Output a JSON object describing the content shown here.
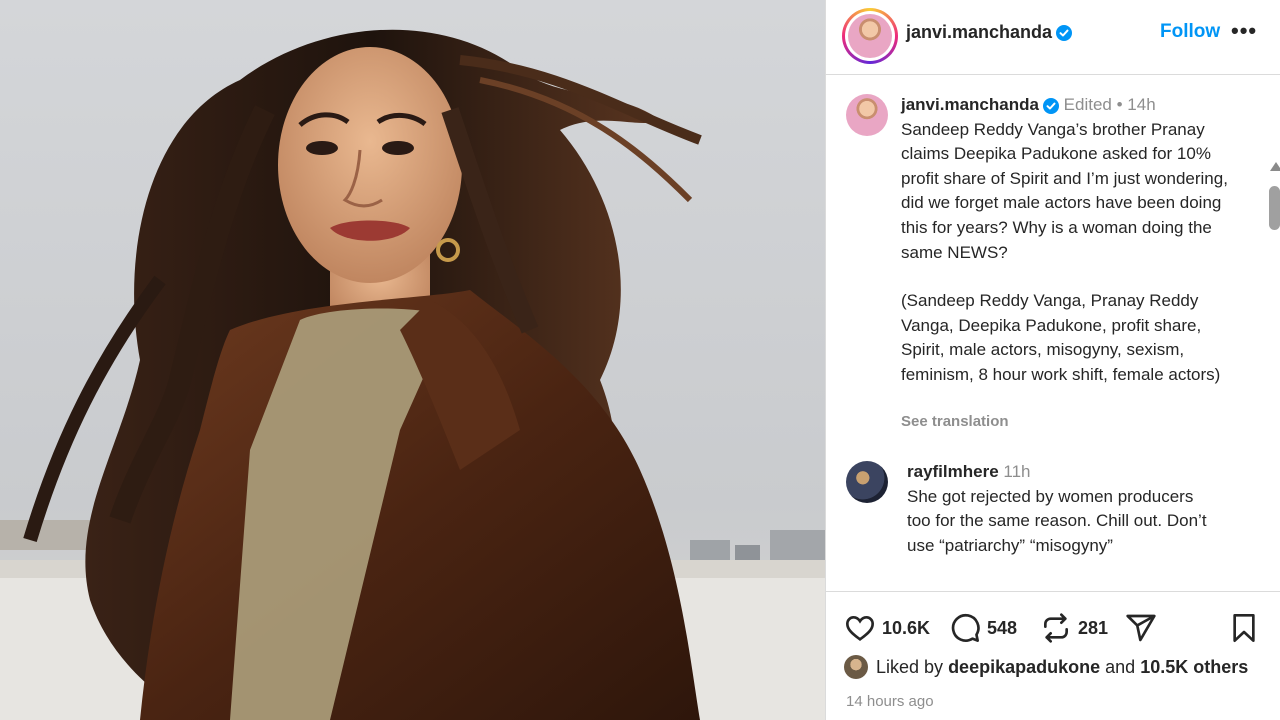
{
  "post": {
    "author": "janvi.manchanda",
    "follow_label": "Follow",
    "more_label": "•••"
  },
  "caption": {
    "username": "janvi.manchanda",
    "edited": "Edited",
    "separator": "•",
    "time": "14h",
    "text": "Sandeep Reddy Vanga’s brother Pranay claims Deepika Padukone asked for 10% profit share of Spirit and I’m just wondering, did we forget male actors have been doing this for years? Why is a woman doing the same NEWS?",
    "tags": "(Sandeep Reddy Vanga, Pranay Reddy Vanga, Deepika Padukone, profit share, Spirit, male actors, misogyny, sexism, feminism, 8 hour work shift, female actors)",
    "see_translation": "See translation"
  },
  "comments": [
    {
      "username": "rayfilmhere",
      "time": "11h",
      "text": "She got rejected by women producers too for the same reason. Chill out. Don’t use “patriarchy” “misogyny”"
    }
  ],
  "actions": {
    "likes": "10.6K",
    "comments": "548",
    "reposts": "281"
  },
  "liked_by": {
    "prefix": "Liked by",
    "user": "deepikapadukone",
    "conjunction": "and",
    "others": "10.5K others"
  },
  "timestamp": "14 hours ago",
  "icons": {
    "verified": "verified-badge-icon",
    "like": "heart-icon",
    "comment": "comment-bubble-icon",
    "repost": "repost-icon",
    "share": "send-icon",
    "save": "bookmark-icon"
  },
  "colors": {
    "accent": "#0095f6",
    "text": "#262626",
    "muted": "#8e8e8e",
    "border": "#dbdbdb"
  }
}
